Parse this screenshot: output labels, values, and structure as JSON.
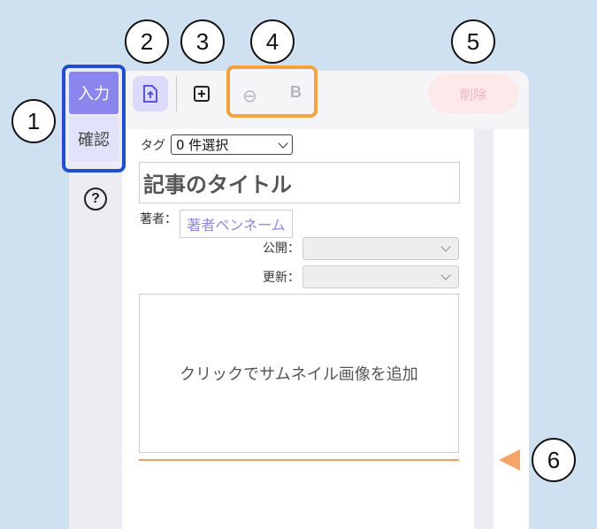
{
  "callouts": [
    "1",
    "2",
    "3",
    "4",
    "5",
    "6"
  ],
  "mode_tabs": {
    "input_label": "入力",
    "confirm_label": "確認"
  },
  "help": {
    "glyph": "?"
  },
  "toolbar": {
    "delete_label": "削除",
    "bold_glyph": "B",
    "link_glyph": "⊖"
  },
  "form": {
    "tag_label": "タグ",
    "tag_value": "0 件選択",
    "title_placeholder": "記事のタイトル",
    "author_label": "著者：",
    "author_placeholder": "著者ペンネーム",
    "published_label": "公開：",
    "updated_label": "更新：",
    "thumbnail_prompt": "クリックでサムネイル画像を追加"
  },
  "colors": {
    "active_tab": "#8a86ee",
    "tab_highlight_border": "#1f4fd0",
    "format_group_border": "#f5a13e",
    "delete_bg": "#fde8ea",
    "accent_line": "#f0a060"
  }
}
